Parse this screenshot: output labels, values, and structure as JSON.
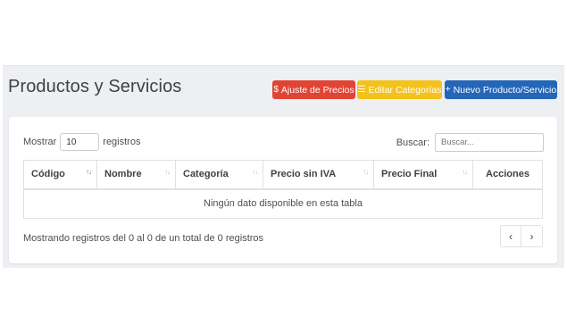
{
  "header": {
    "title": "Productos y Servicios",
    "buttons": {
      "adjust_prices": {
        "icon": "dollar-icon",
        "icon_glyph": "$",
        "label": "Ajuste de Precios",
        "color": "#e14434"
      },
      "edit_categories": {
        "icon": "list-icon",
        "icon_glyph": "☰",
        "label": "Editar Categorías",
        "color": "#f4c21c"
      },
      "new_product": {
        "icon": "plus-icon",
        "icon_glyph": "+",
        "label": "Nuevo Producto/Servicio",
        "color": "#2466b8"
      }
    }
  },
  "table_controls": {
    "show_label": "Mostrar",
    "page_length": "10",
    "records_label": "registros",
    "search_label": "Buscar:",
    "search_placeholder": "Buscar..."
  },
  "table": {
    "columns": [
      "Código",
      "Nombre",
      "Categoría",
      "Precio sin IVA",
      "Precio Final",
      "Acciones"
    ],
    "empty_message": "Ningún dato disponible en esta tabla"
  },
  "footer": {
    "info": "Mostrando registros del 0 al 0 de un total de 0 registros",
    "prev_glyph": "‹",
    "next_glyph": "›"
  }
}
